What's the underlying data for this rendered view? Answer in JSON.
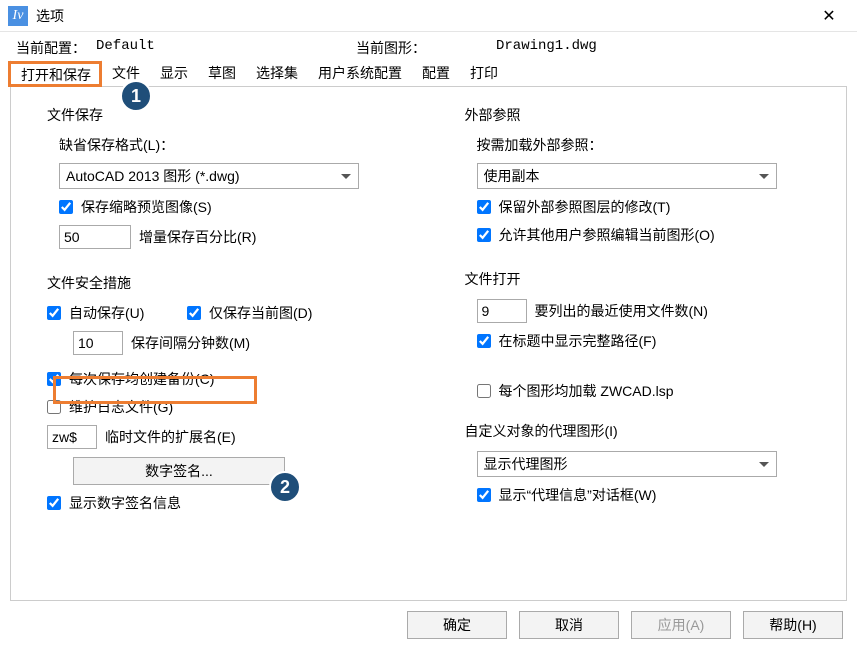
{
  "window": {
    "title": "选项",
    "close": "✕"
  },
  "header": {
    "config_label": "当前配置：",
    "config_value": "Default",
    "drawing_label": "当前图形：",
    "drawing_value": "Drawing1.dwg"
  },
  "tabs": [
    "打开和保存",
    "文件",
    "显示",
    "草图",
    "选择集",
    "用户系统配置",
    "配置",
    "打印"
  ],
  "badges": {
    "one": "1",
    "two": "2"
  },
  "left": {
    "file_save": {
      "title": "文件保存",
      "format_label": "缺省保存格式(L)：",
      "format_value": "AutoCAD 2013 图形 (*.dwg)",
      "thumbnail": "保存缩略预览图像(S)",
      "incr_value": "50",
      "incr_label": "增量保存百分比(R)"
    },
    "file_safety": {
      "title": "文件安全措施",
      "autosave": "自动保存(U)",
      "only_current": "仅保存当前图(D)",
      "interval_value": "10",
      "interval_label": "保存间隔分钟数(M)",
      "backup": "每次保存均创建备份(C)",
      "log": "维护日志文件(G)",
      "tmp_value": "zw$",
      "tmp_label": "临时文件的扩展名(E)",
      "sig_btn": "数字签名...",
      "show_sig": "显示数字签名信息"
    }
  },
  "right": {
    "xref": {
      "title": "外部参照",
      "load_label": "按需加载外部参照：",
      "load_value": "使用副本",
      "retain": "保留外部参照图层的修改(T)",
      "allow_other": "允许其他用户参照编辑当前图形(O)"
    },
    "file_open": {
      "title": "文件打开",
      "recent_value": "9",
      "recent_label": "要列出的最近使用文件数(N)",
      "fullpath": "在标题中显示完整路径(F)"
    },
    "lisp": {
      "load_each": "每个图形均加载 ZWCAD.lsp"
    },
    "proxy": {
      "title": "自定义对象的代理图形(I)",
      "select_value": "显示代理图形",
      "show_dialog": "显示“代理信息”对话框(W)"
    }
  },
  "footer": {
    "ok": "确定",
    "cancel": "取消",
    "apply": "应用(A)",
    "help": "帮助(H)"
  }
}
